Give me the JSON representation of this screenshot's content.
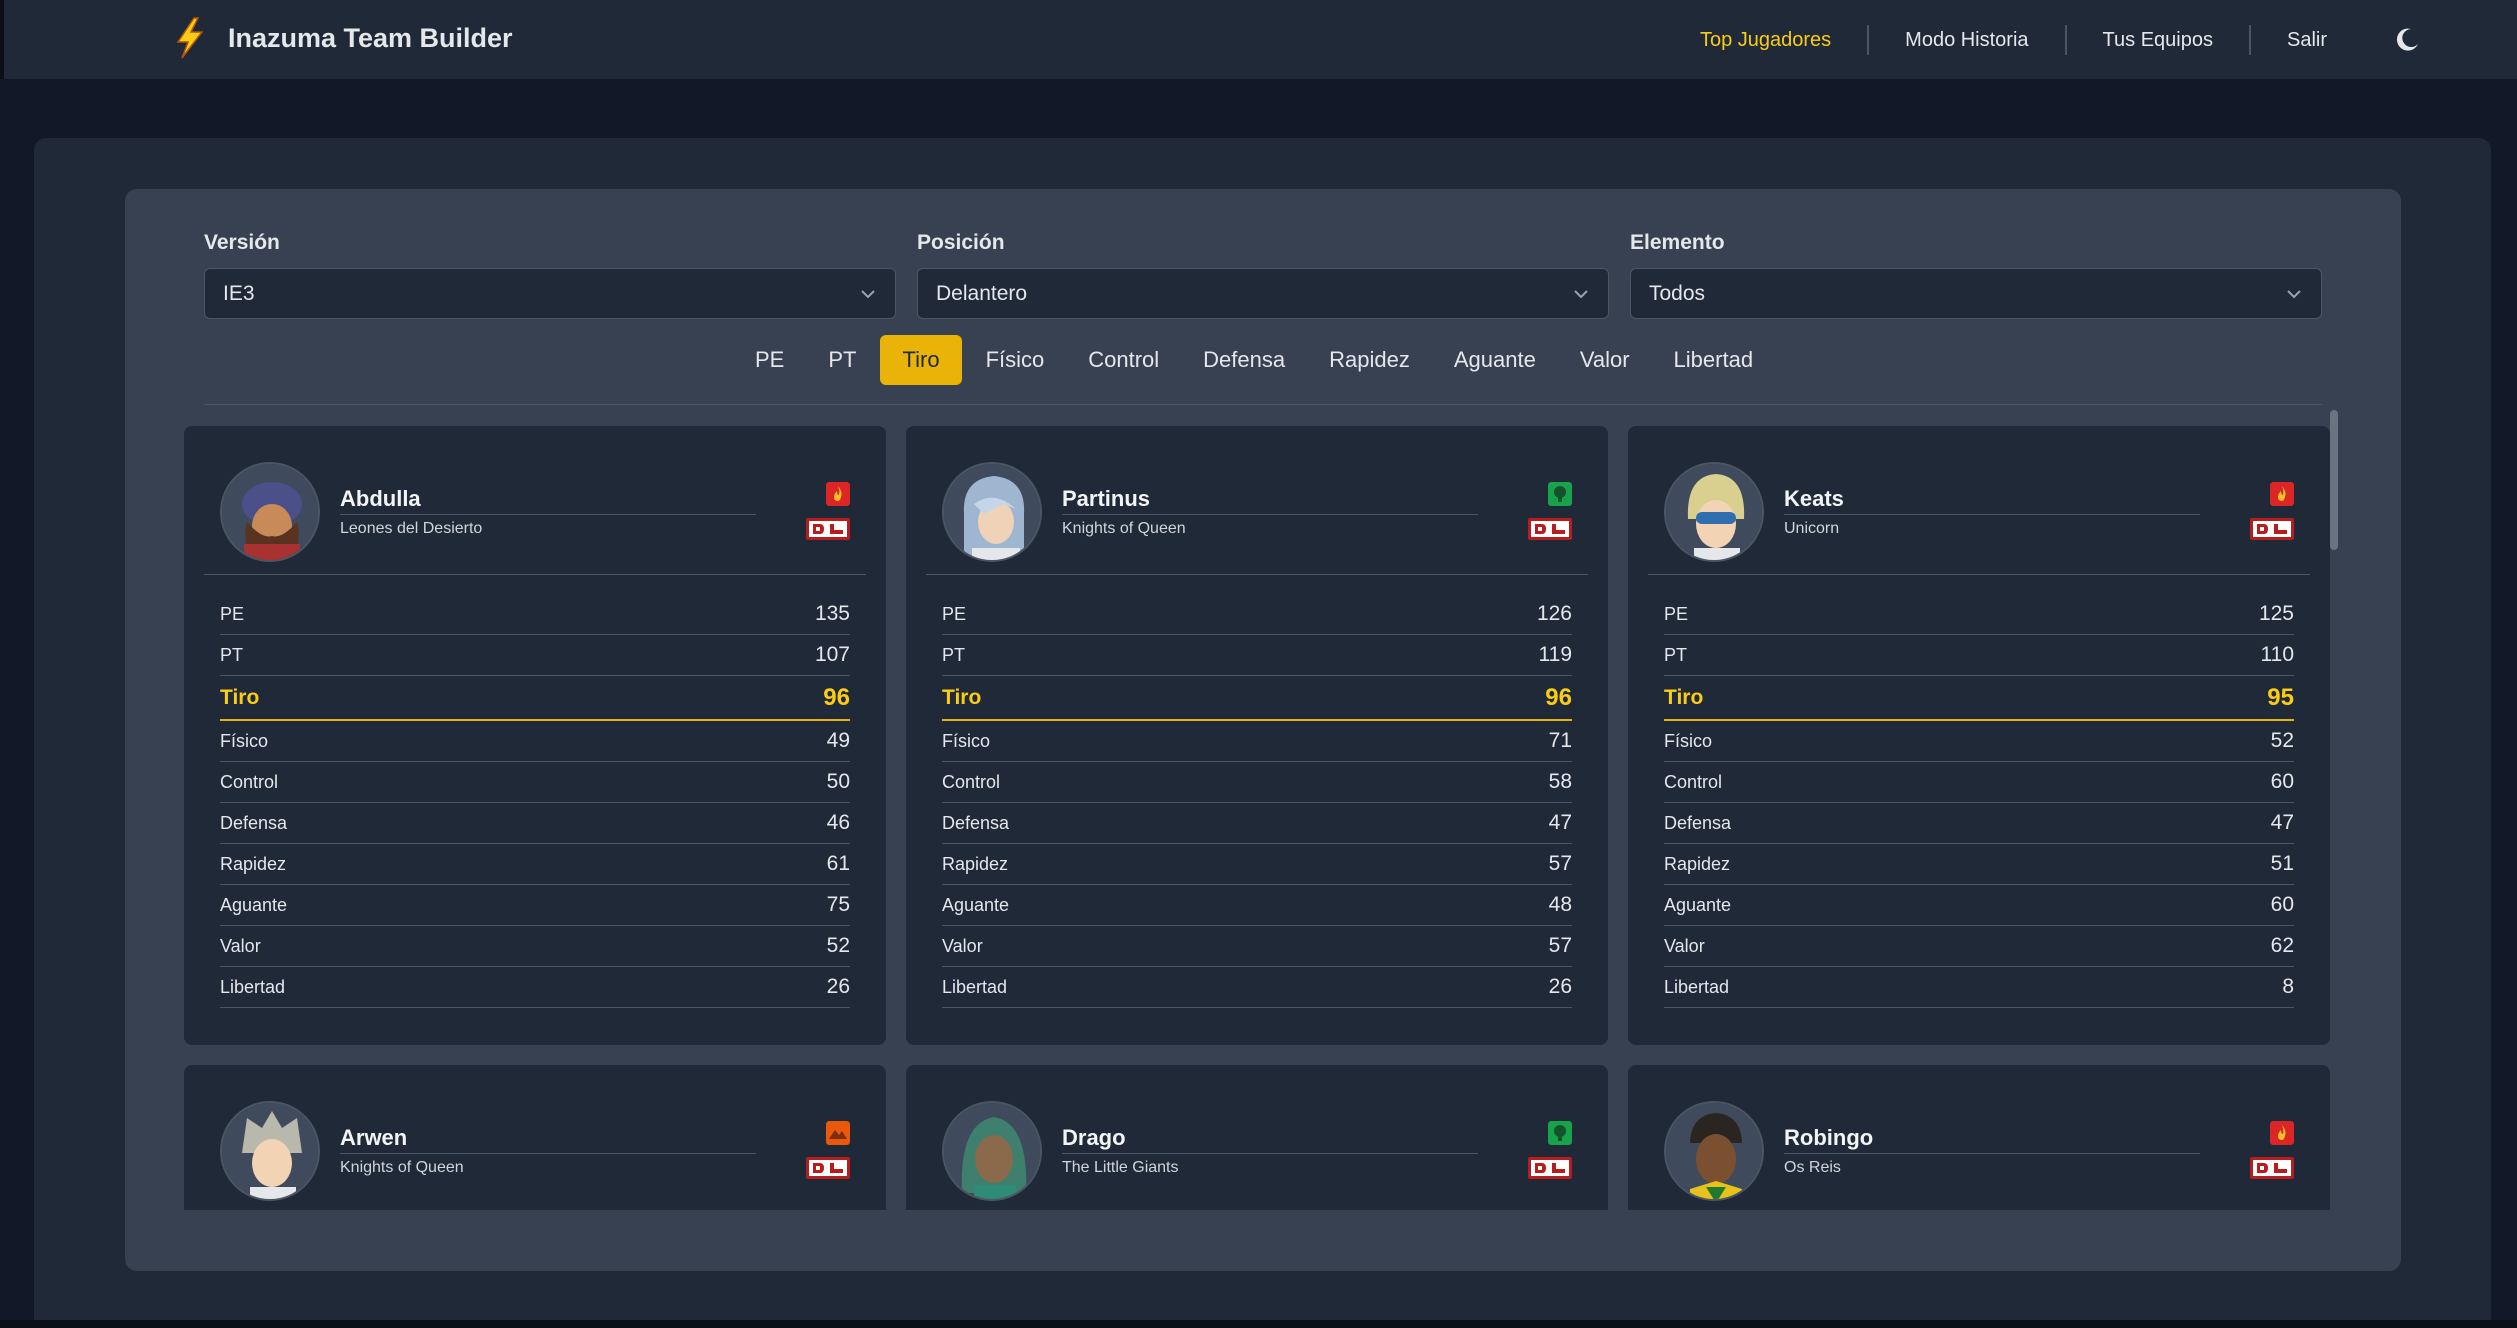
{
  "app": {
    "title": "Inazuma Team Builder",
    "brand_icon": "lightning-icon",
    "accent": "#eab308"
  },
  "nav": {
    "links": [
      {
        "label": "Top Jugadores",
        "active": true
      },
      {
        "label": "Modo Historia",
        "active": false
      },
      {
        "label": "Tus Equipos",
        "active": false
      },
      {
        "label": "Salir",
        "active": false
      }
    ],
    "theme_toggle_icon": "moon-icon"
  },
  "filters": {
    "version": {
      "label": "Versión",
      "value": "IE3"
    },
    "position": {
      "label": "Posición",
      "value": "Delantero"
    },
    "element": {
      "label": "Elemento",
      "value": "Todos"
    }
  },
  "tabs": {
    "items": [
      "PE",
      "PT",
      "Tiro",
      "Físico",
      "Control",
      "Defensa",
      "Rapidez",
      "Aguante",
      "Valor",
      "Libertad"
    ],
    "active": "Tiro"
  },
  "stat_labels": [
    "PE",
    "PT",
    "Tiro",
    "Físico",
    "Control",
    "Defensa",
    "Rapidez",
    "Aguante",
    "Valor",
    "Libertad"
  ],
  "players": [
    {
      "name": "Abdulla",
      "team": "Leones del Desierto",
      "element": "fire",
      "element_color": "#dc2626",
      "position_badge": "DL",
      "stats": [
        135,
        107,
        96,
        49,
        50,
        46,
        61,
        75,
        52,
        26
      ]
    },
    {
      "name": "Partinus",
      "team": "Knights of Queen",
      "element": "wood",
      "element_color": "#16a34a",
      "position_badge": "DL",
      "stats": [
        126,
        119,
        96,
        71,
        58,
        47,
        57,
        48,
        57,
        26
      ]
    },
    {
      "name": "Keats",
      "team": "Unicorn",
      "element": "fire",
      "element_color": "#dc2626",
      "position_badge": "DL",
      "stats": [
        125,
        110,
        95,
        52,
        60,
        47,
        51,
        60,
        62,
        8
      ]
    },
    {
      "name": "Arwen",
      "team": "Knights of Queen",
      "element": "earth",
      "element_color": "#ea580c",
      "position_badge": "DL"
    },
    {
      "name": "Drago",
      "team": "The Little Giants",
      "element": "wood",
      "element_color": "#16a34a",
      "position_badge": "DL"
    },
    {
      "name": "Robingo",
      "team": "Os Reis",
      "element": "fire",
      "element_color": "#dc2626",
      "position_badge": "DL"
    }
  ]
}
